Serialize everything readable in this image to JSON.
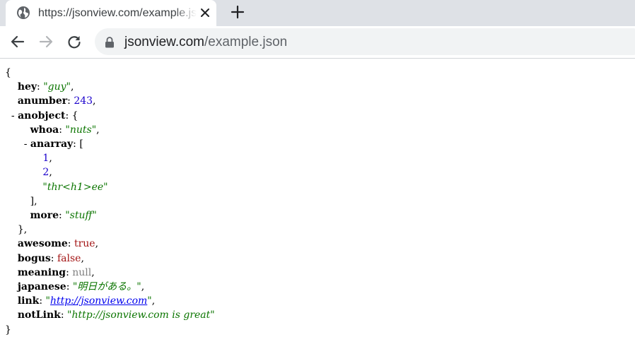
{
  "browser": {
    "tab": {
      "title": "https://jsonview.com/example.json",
      "icon": "globe-icon"
    },
    "address_bar": {
      "host": "jsonview.com",
      "path": "/example.json",
      "icon": "lock-icon"
    }
  },
  "json_view": {
    "open_brace": "{",
    "close_brace": "}",
    "hey": {
      "key": "hey",
      "value": "\"guy\""
    },
    "anumber": {
      "key": "anumber",
      "value": "243"
    },
    "anobject": {
      "toggle": "-",
      "key": "anobject",
      "open": "{",
      "close": "},",
      "whoa": {
        "key": "whoa",
        "value": "\"nuts\""
      },
      "anarray": {
        "toggle": "-",
        "key": "anarray",
        "open": "[",
        "close": "],",
        "items": [
          "1",
          "2",
          "\"thr<h1>ee\""
        ]
      },
      "more": {
        "key": "more",
        "value": "\"stuff\""
      }
    },
    "awesome": {
      "key": "awesome",
      "value": "true"
    },
    "bogus": {
      "key": "bogus",
      "value": "false"
    },
    "meaning": {
      "key": "meaning",
      "value": "null"
    },
    "japanese": {
      "key": "japanese",
      "value": "\"明日がある。\""
    },
    "link": {
      "key": "link",
      "value": "http://jsonview.com"
    },
    "notLink": {
      "key": "notLink",
      "value": "\"http://jsonview.com is great\""
    }
  },
  "colors": {
    "string": "#0b7500",
    "number": "#1a01cc",
    "boolean": "#a31515",
    "null": "#808080",
    "link": "#0000ee"
  }
}
